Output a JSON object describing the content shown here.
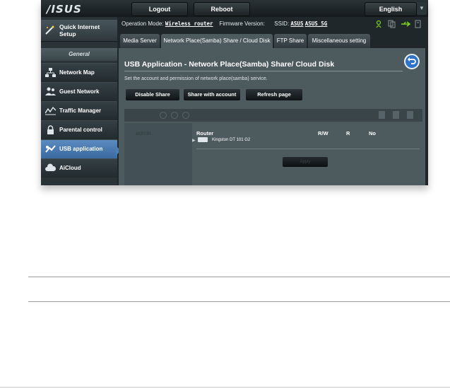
{
  "header": {
    "logo": "/ISUS",
    "logout_label": "Logout",
    "reboot_label": "Reboot",
    "language": "English"
  },
  "sidebar": {
    "quick_setup_line1": "Quick Internet",
    "quick_setup_line2": "Setup",
    "section_label": "General",
    "items": [
      {
        "label": "Network Map",
        "icon": "network-map-icon"
      },
      {
        "label": "Guest Network",
        "icon": "guest-network-icon"
      },
      {
        "label": "Traffic Manager",
        "icon": "traffic-manager-icon"
      },
      {
        "label": "Parental control",
        "icon": "parental-control-icon"
      },
      {
        "label": "USB application",
        "icon": "usb-application-icon",
        "active": true
      },
      {
        "label": "AiCloud",
        "icon": "aicloud-icon"
      }
    ]
  },
  "status": {
    "op_mode_label": "Operation Mode:",
    "op_mode_value": "Wireless router",
    "firmware_label": "Firmware Version:",
    "ssid_label": "SSID:",
    "ssid_1": "ASUS",
    "ssid_2": "ASUS_5G"
  },
  "tabs": [
    {
      "label": "Media Server"
    },
    {
      "label": "Network Place(Samba) Share / Cloud Disk",
      "active": true
    },
    {
      "label": "FTP Share"
    },
    {
      "label": "Miscellaneous setting"
    }
  ],
  "panel": {
    "title": "USB Application - Network Place(Samba) Share/ Cloud Disk",
    "description": "Set the account and permission of network place(samba) service.",
    "buttons": {
      "disable_share": "Disable Share",
      "share_with_account": "Share with account",
      "refresh_page": "Refresh page"
    },
    "account": "admin",
    "headers": {
      "router": "Router",
      "rw": "R/W",
      "r": "R",
      "no": "No"
    },
    "drive_label": "Kingston DT 101 G2",
    "apply_label": "Apply"
  },
  "colors": {
    "accent": "#4d7db4",
    "background": "#1f272a"
  }
}
